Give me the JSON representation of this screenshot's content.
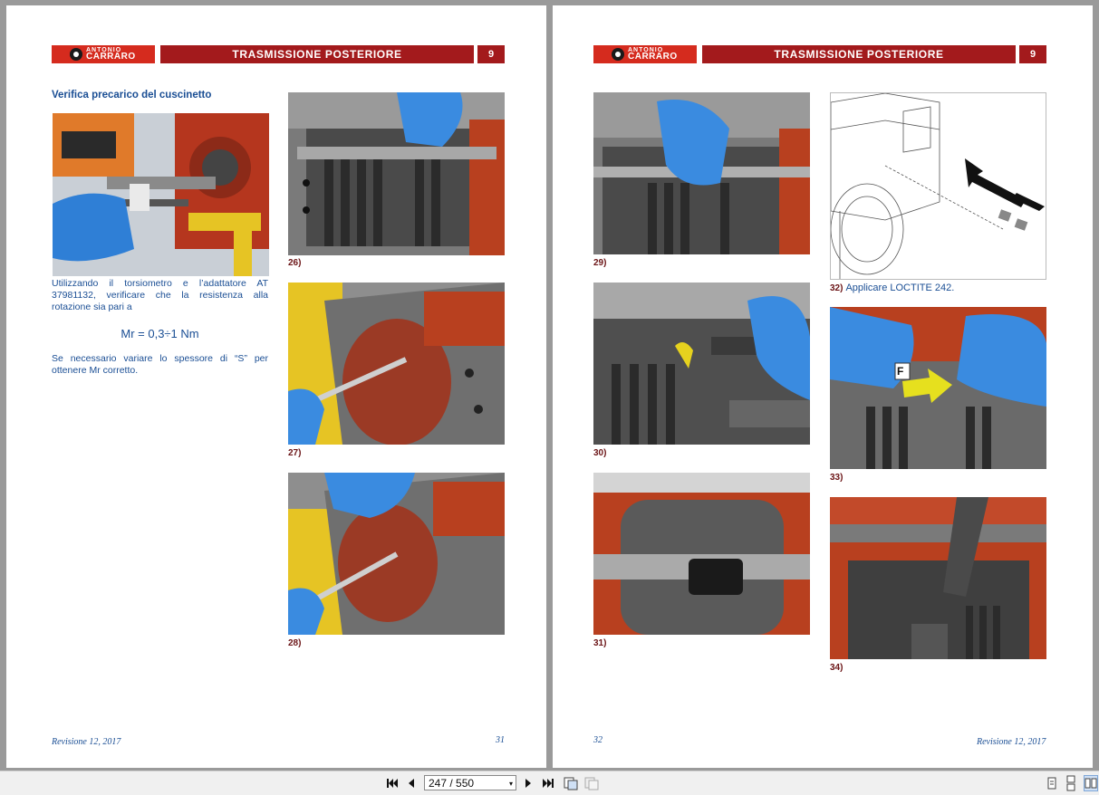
{
  "header": {
    "logo_line1": "ANTONIO",
    "logo_line2": "CARRARO",
    "title": "TRASMISSIONE POSTERIORE",
    "chapter": "9"
  },
  "left_page": {
    "section_title": "Verifica precarico del cuscinetto",
    "para1": "Utilizzando il torsiometro e l’adattatore AT 37981132, verificare che la resistenza alla rotazione sia pari a",
    "formula": "Mr = 0,3÷1 Nm",
    "para2": "Se necessario variare lo spessore di “S” per ottenere Mr corretto.",
    "captions": [
      "26)",
      "27)",
      "28)"
    ],
    "footer_revision": "Revisione 12, 2017",
    "page_number": "31"
  },
  "right_page": {
    "captions": [
      "29)",
      "30)",
      "31)",
      "32)",
      "33)",
      "34)"
    ],
    "caption_32_note": "Applicare LOCTITE 242.",
    "callout_label": "F",
    "footer_revision": "Revisione 12, 2017",
    "page_number": "32"
  },
  "toolbar": {
    "page_indicator": "247 / 550",
    "icons": [
      "first-page-icon",
      "prev-page-icon",
      "next-page-icon",
      "last-page-icon",
      "copy-icon",
      "paste-icon",
      "single-page-icon",
      "continuous-page-icon",
      "two-page-icon"
    ]
  },
  "colors": {
    "brand_red": "#d52b1e",
    "header_dark_red": "#a31a1c",
    "text_blue": "#1a4e94",
    "caption_red": "#6b1416"
  }
}
